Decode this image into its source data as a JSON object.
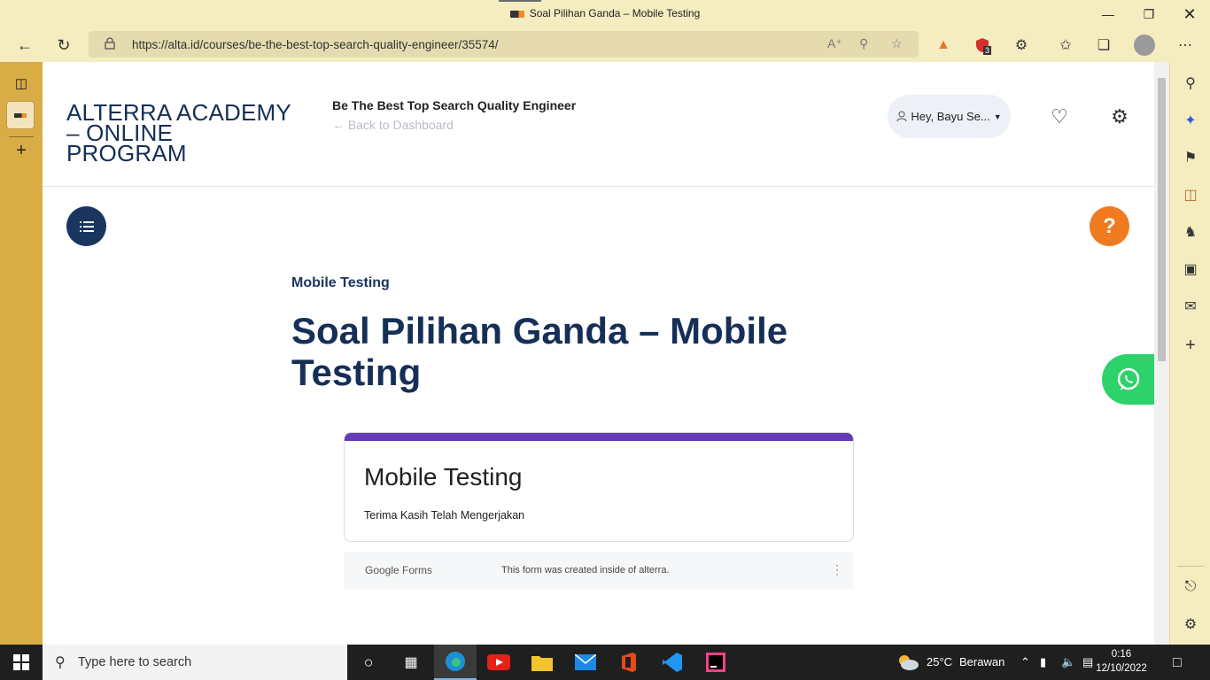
{
  "browser": {
    "window_title": "Soal Pilihan Ganda – Mobile Testing",
    "url": "https://alta.id/courses/be-the-best-top-search-quality-engineer/35574/",
    "extension_badge": "3"
  },
  "site": {
    "logo_line1": "ALTERRA ACADEMY",
    "logo_line2": "– ONLINE",
    "logo_line3": "PROGRAM",
    "course_title": "Be The Best Top Search Quality Engineer",
    "back_link": "Back to Dashboard",
    "user_greeting": "Hey, Bayu Se...",
    "help_label": "?"
  },
  "lesson": {
    "subtitle": "Mobile Testing",
    "title_line1": "Soal Pilihan Ganda – Mobile",
    "title_line2": "Testing"
  },
  "form": {
    "title": "Mobile Testing",
    "message": "Terima Kasih Telah Mengerjakan",
    "brand": "Google Forms",
    "footer_note": "This form was created inside of alterra.",
    "accent_color": "#673ab7"
  },
  "taskbar": {
    "search_placeholder": "Type here to search",
    "weather_temp": "25°C",
    "weather_desc": "Berawan",
    "time": "0:16",
    "date": "12/10/2022"
  },
  "colors": {
    "navy": "#152f57",
    "orange": "#f07a20",
    "whatsapp": "#2ed26a",
    "browser_theme": "#f5ecc0",
    "vertical_tabs": "#d9ad45"
  }
}
